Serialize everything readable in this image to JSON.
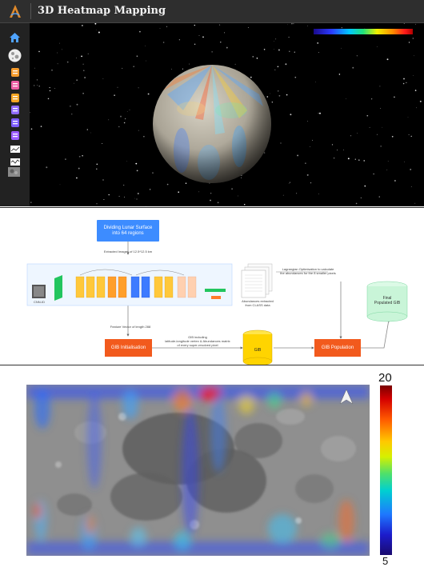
{
  "app": {
    "title": "3D Heatmap Mapping",
    "sidebar_icons": [
      "home-icon",
      "moon-globe-icon",
      "element-map-icon-1",
      "element-map-icon-2",
      "element-map-icon-3",
      "element-map-icon-4",
      "element-map-icon-5",
      "element-map-icon-6",
      "chart-view-icon-1",
      "chart-view-icon-2",
      "surface-image-icon"
    ],
    "colors": {
      "titlebar": "#2e2e2e",
      "sidebar": "#222222",
      "viewport": "#000000",
      "home_icon": "#4fa3ff"
    }
  },
  "diagram": {
    "dividing_box": "Dividing Lunar Surface\ninto 64 regions",
    "extracted_images": "Extracted Images of 12.5*12.5 km",
    "network_input_label": "CNN-ID",
    "feature_vector": "Feature Vector of length 288",
    "gib_init": "GIB Initialisation",
    "gib_including": "GIB including\nlatitude-longitude vertex & Abundances matrix\nof every super-resolved pixel",
    "gib": "GIB",
    "gib_population": "GIB Population",
    "abundances_extracted": "Abundances extracted\nfrom CLASS data",
    "lagrangian": "Lagrangian Optimisation to calculate\nthe abundances for the 8 smaller pixels",
    "final_gib": "Final\nPopulated GIB",
    "colors": {
      "blue_box": "#3d8cff",
      "orange_box": "#f25a1d",
      "yellow_cyl": "#ffd400",
      "green_cyl": "#c9f5d8"
    }
  },
  "map": {
    "colorbar_max": "20",
    "colorbar_min": "5",
    "north_arrow": "north-arrow-icon"
  }
}
